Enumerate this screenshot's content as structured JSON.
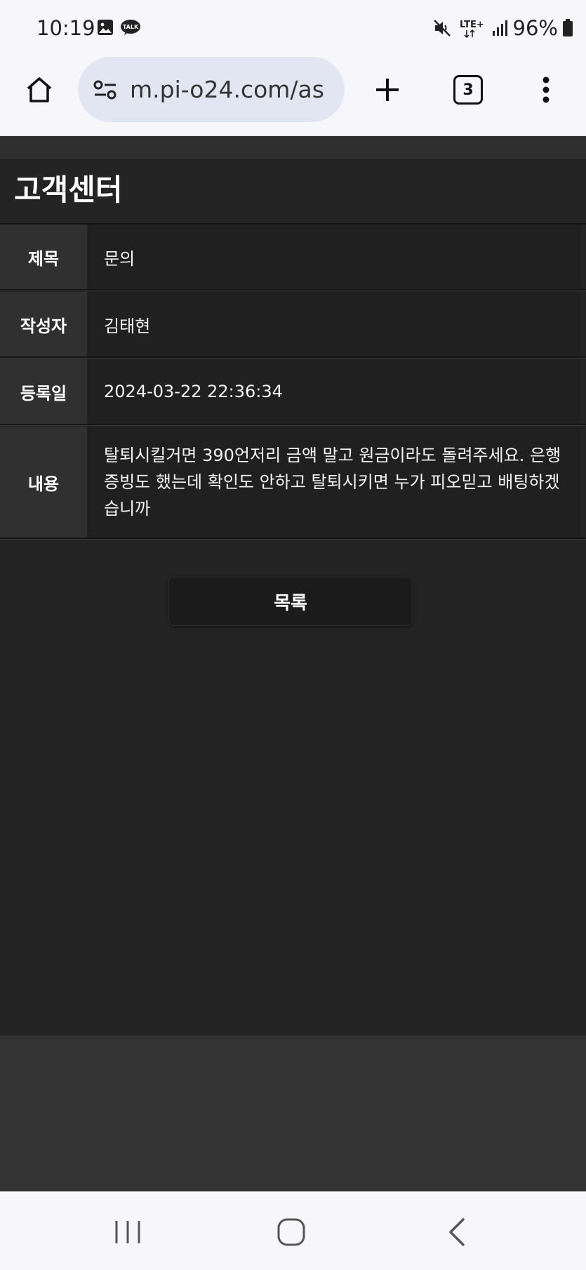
{
  "status_bar": {
    "time": "10:19",
    "icons": [
      "image-icon",
      "kakao-talk-icon",
      "mute-icon",
      "lte-icon",
      "signal-icon",
      "battery-icon"
    ],
    "talk_label": "TALK",
    "network": "LTE+",
    "battery": "96%"
  },
  "browser": {
    "url": "m.pi-o24.com/as",
    "tab_count": "3",
    "icons": [
      "home-icon",
      "tune-icon",
      "plus-icon",
      "more-vert-icon"
    ]
  },
  "page": {
    "title": "고객센터",
    "rows": [
      {
        "label": "제목",
        "value": "문의"
      },
      {
        "label": "작성자",
        "value": "김태현"
      },
      {
        "label": "등록일",
        "value": "2024-03-22 22:36:34"
      },
      {
        "label": "내용",
        "value": "탈퇴시킬거면 390언저리 금액 말고 원금이라도 돌려주세요. 은행증빙도 했는데 확인도 안하고 탈퇴시키면 누가 피오믿고 배팅하겠습니까"
      }
    ],
    "list_button": "목록"
  },
  "nav_bar": {
    "icons": [
      "recents-icon",
      "home-circle-icon",
      "back-icon"
    ]
  },
  "colors": {
    "page_bg": "#242424",
    "label_bg": "#303030",
    "value_bg": "#202020",
    "chrome_bg": "#f7f7fb",
    "url_pill": "#e2e6f2"
  }
}
